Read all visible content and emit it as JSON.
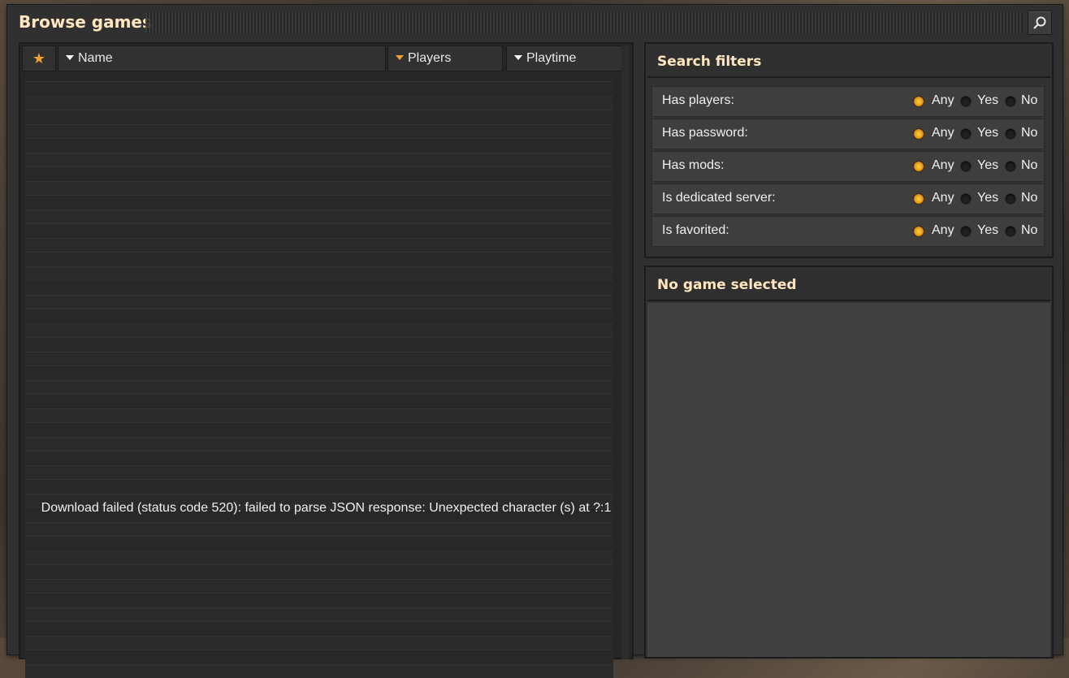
{
  "window": {
    "title": "Browse games"
  },
  "table": {
    "columns": [
      {
        "label": "Name"
      },
      {
        "label": "Players"
      },
      {
        "label": "Playtime"
      }
    ],
    "error_message": "Download failed (status code 520): failed to parse JSON response: Unexpected character (s) at ?:1"
  },
  "filters": {
    "title": "Search filters",
    "options": [
      "Any",
      "Yes",
      "No"
    ],
    "rows": [
      {
        "label": "Has players:",
        "selected": "Any"
      },
      {
        "label": "Has password:",
        "selected": "Any"
      },
      {
        "label": "Has mods:",
        "selected": "Any"
      },
      {
        "label": "Is dedicated server:",
        "selected": "Any"
      },
      {
        "label": "Is favorited:",
        "selected": "Any"
      }
    ]
  },
  "details": {
    "title": "No game selected"
  },
  "colors": {
    "accent": "#f0a030",
    "title": "#ffe6c0"
  }
}
